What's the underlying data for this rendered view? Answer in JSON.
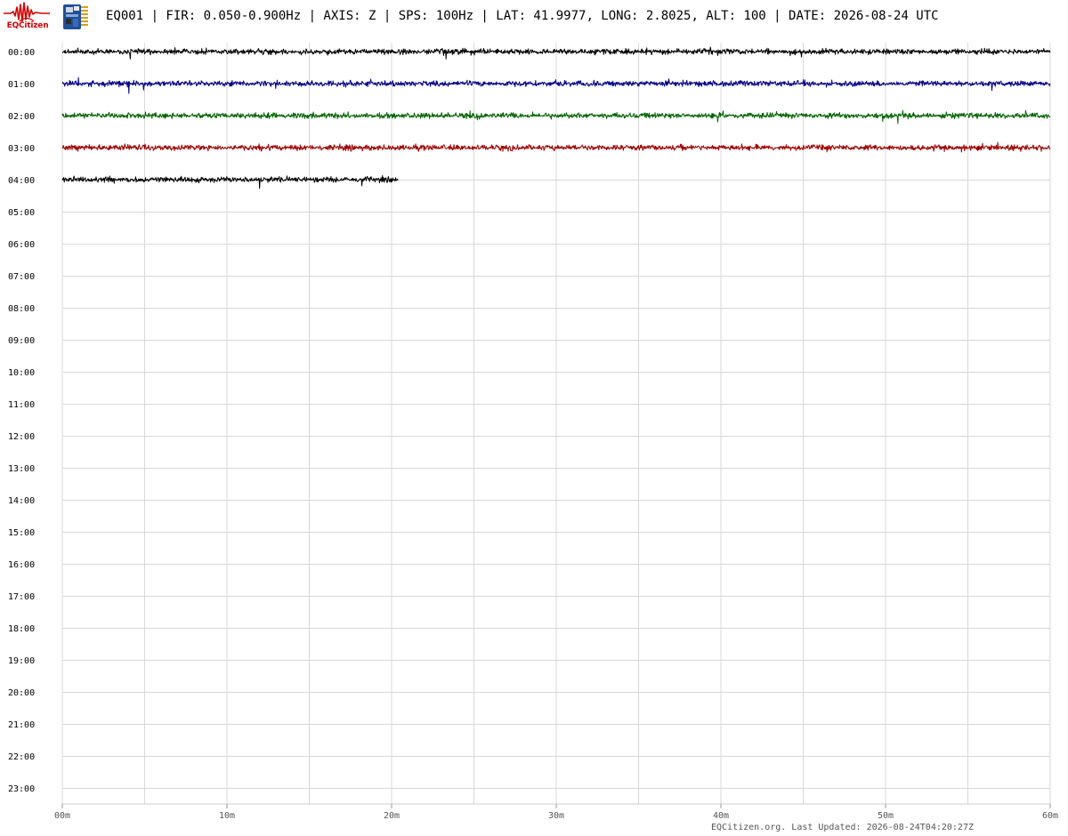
{
  "header": {
    "logo_text": "EQCitizen",
    "title": "EQ001 | FIR: 0.050-0.900Hz | AXIS: Z | SPS: 100Hz | LAT: 41.9977, LONG: 2.8025, ALT: 100 | DATE: 2026-08-24 UTC"
  },
  "footer": {
    "note": "EQCitizen.org. Last Updated: 2026-08-24T04:20:27Z"
  },
  "colors": {
    "trace_cycle": [
      "#000000",
      "#00008b",
      "#006400",
      "#a00000"
    ],
    "grid": "#d8d8d8",
    "logo_red": "#d40000",
    "board_blue": "#1f4e9a"
  },
  "chart_data": {
    "type": "line",
    "title": "",
    "xlabel": "",
    "ylabel": "",
    "x_ticks": [
      "00m",
      "10m",
      "20m",
      "30m",
      "40m",
      "50m",
      "60m"
    ],
    "x_range_minutes": [
      0,
      60
    ],
    "minor_grid_every_minutes": 5,
    "y_rows": [
      "00:00",
      "01:00",
      "02:00",
      "03:00",
      "04:00",
      "05:00",
      "06:00",
      "07:00",
      "08:00",
      "09:00",
      "10:00",
      "11:00",
      "12:00",
      "13:00",
      "14:00",
      "15:00",
      "16:00",
      "17:00",
      "18:00",
      "19:00",
      "20:00",
      "21:00",
      "22:00",
      "23:00"
    ],
    "grid": true,
    "series": [
      {
        "row": "00:00",
        "start_minute": 0,
        "end_minute": 60,
        "color": "#000000"
      },
      {
        "row": "01:00",
        "start_minute": 0,
        "end_minute": 60,
        "color": "#00008b"
      },
      {
        "row": "02:00",
        "start_minute": 0,
        "end_minute": 60,
        "color": "#006400"
      },
      {
        "row": "03:00",
        "start_minute": 0,
        "end_minute": 60,
        "color": "#a00000"
      },
      {
        "row": "04:00",
        "start_minute": 0,
        "end_minute": 20.4,
        "color": "#000000"
      }
    ]
  }
}
